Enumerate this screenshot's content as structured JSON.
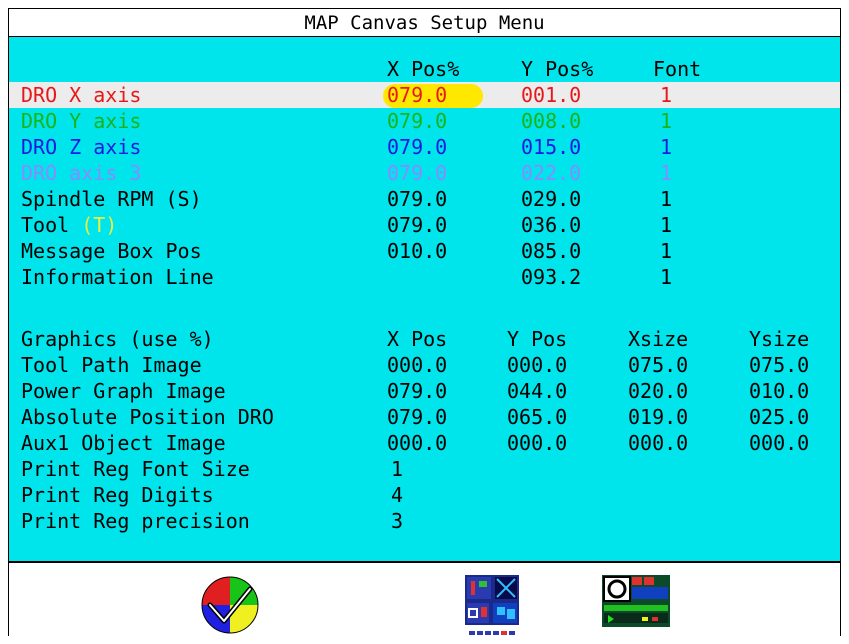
{
  "title": "MAP Canvas Setup Menu",
  "dro_section": {
    "headers": {
      "xpos": "X Pos%",
      "ypos": "Y Pos%",
      "font": "Font"
    },
    "rows": [
      {
        "label": "DRO X axis",
        "label_extra": "",
        "x": "079.0",
        "y": "001.0",
        "font": "1",
        "color": "#e81818"
      },
      {
        "label": "DRO Y axis",
        "label_extra": "",
        "x": "079.0",
        "y": "008.0",
        "font": "1",
        "color": "#18b418"
      },
      {
        "label": "DRO Z axis",
        "label_extra": "",
        "x": "079.0",
        "y": "015.0",
        "font": "1",
        "color": "#1a1ae0"
      },
      {
        "label": "DRO axis 3",
        "label_extra": "",
        "x": "079.0",
        "y": "022.0",
        "font": "1",
        "color": "#8a8aff"
      },
      {
        "label": "Spindle RPM (S)",
        "label_extra": "",
        "x": "079.0",
        "y": "029.0",
        "font": "1",
        "color": "#000000"
      },
      {
        "label": "Tool ",
        "label_extra": "(T)",
        "x": "079.0",
        "y": "036.0",
        "font": "1",
        "color": "#000000"
      },
      {
        "label": "Message Box Pos",
        "label_extra": "",
        "x": "010.0",
        "y": "085.0",
        "font": "1",
        "color": "#000000"
      },
      {
        "label": "Information Line",
        "label_extra": "",
        "x": "",
        "y": "093.2",
        "font": "1",
        "color": "#000000"
      }
    ],
    "tool_extra_color": "#e8f040"
  },
  "graphics_section": {
    "headers": {
      "label": "Graphics (use %)",
      "xpos": "X Pos",
      "ypos": "Y Pos",
      "xsize": "Xsize",
      "ysize": "Ysize"
    },
    "rows": [
      {
        "label": "Tool Path Image",
        "x": "000.0",
        "y": "000.0",
        "xs": "075.0",
        "ys": "075.0"
      },
      {
        "label": "Power Graph Image",
        "x": "079.0",
        "y": "044.0",
        "xs": "020.0",
        "ys": "010.0"
      },
      {
        "label": "Absolute Position DRO",
        "x": "079.0",
        "y": "065.0",
        "xs": "019.0",
        "ys": "025.0"
      },
      {
        "label": "Aux1 Object Image",
        "x": "000.0",
        "y": "000.0",
        "xs": "000.0",
        "ys": "000.0"
      }
    ],
    "print_rows": [
      {
        "label": "Print Reg Font Size",
        "value": "1"
      },
      {
        "label": "Print Reg Digits",
        "value": "4"
      },
      {
        "label": "Print Reg precision",
        "value": "3"
      }
    ]
  },
  "footer_icons": [
    "color-wheel-checkmark-icon",
    "grid-layout-icon",
    "canvas-preview-icon"
  ]
}
